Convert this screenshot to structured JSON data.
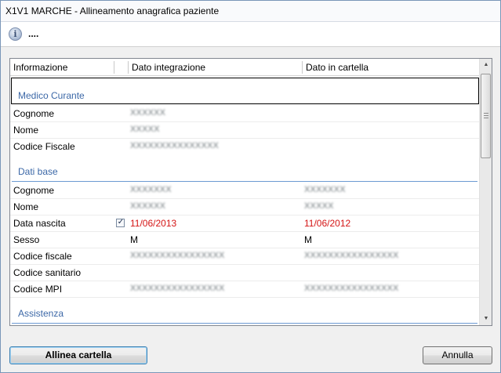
{
  "window": {
    "title": "X1V1 MARCHE - Allineamento anagrafica paziente"
  },
  "info": {
    "icon": "info-icon",
    "text": "...."
  },
  "grid": {
    "columns": [
      "Informazione",
      "Dato integrazione",
      "Dato in cartella"
    ],
    "sections": [
      {
        "title": "Medico Curante",
        "rows": [
          {
            "label": "Cognome",
            "integrazione": "XXXXXX",
            "cartella": ""
          },
          {
            "label": "Nome",
            "integrazione": "XXXXX",
            "cartella": ""
          },
          {
            "label": "Codice Fiscale",
            "integrazione": "XXXXXXXXXXXXXXX",
            "cartella": ""
          }
        ]
      },
      {
        "title": "Dati base",
        "rows": [
          {
            "label": "Cognome",
            "integrazione": "XXXXXXX",
            "cartella": "XXXXXXX"
          },
          {
            "label": "Nome",
            "integrazione": "XXXXXX",
            "cartella": "XXXXX"
          },
          {
            "label": "Data nascita",
            "checked": true,
            "integrazione": "11/06/2013",
            "cartella": "11/06/2012",
            "mismatch": true
          },
          {
            "label": "Sesso",
            "integrazione": "M",
            "cartella": "M"
          },
          {
            "label": "Codice fiscale",
            "integrazione": "XXXXXXXXXXXXXXXX",
            "cartella": "XXXXXXXXXXXXXXXX"
          },
          {
            "label": "Codice sanitario",
            "integrazione": "",
            "cartella": ""
          },
          {
            "label": "Codice MPI",
            "integrazione": "XXXXXXXXXXXXXXXX",
            "cartella": "XXXXXXXXXXXXXXXX"
          }
        ]
      },
      {
        "title": "Assistenza",
        "rows": []
      }
    ]
  },
  "buttons": {
    "align": "Allinea cartella",
    "cancel": "Annulla"
  },
  "colors": {
    "section_title": "#3c68a7",
    "mismatch": "#d41414",
    "accent_border": "#3c7fb1"
  }
}
